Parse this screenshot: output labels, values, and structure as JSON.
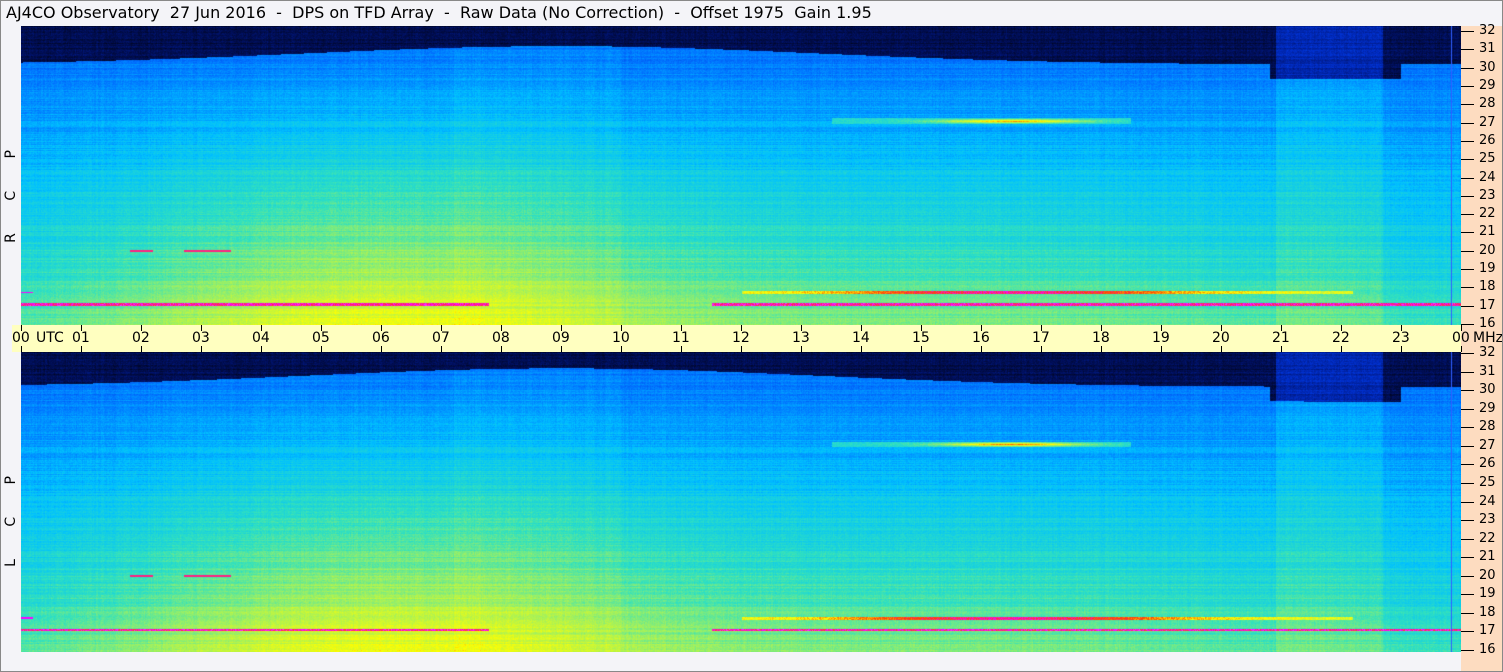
{
  "title": "AJ4CO Observatory  27 Jun 2016  -  DPS on TFD Array  -  Raw Data (No Correction)  -  Offset 1975  Gain 1.95",
  "chart_data": {
    "type": "heatmap",
    "title": "AJ4CO Observatory  27 Jun 2016  -  DPS on TFD Array  -  Raw Data (No Correction)  -  Offset 1975  Gain 1.95",
    "panels": [
      {
        "label": "R C P",
        "polarization": "RCP"
      },
      {
        "label": "L C P",
        "polarization": "LCP"
      }
    ],
    "x_axis": {
      "unit_label": "UTC",
      "range_hours": [
        0,
        24
      ],
      "tick_labels": [
        "00",
        "01",
        "02",
        "03",
        "04",
        "05",
        "06",
        "07",
        "08",
        "09",
        "10",
        "11",
        "12",
        "13",
        "14",
        "15",
        "16",
        "17",
        "18",
        "19",
        "20",
        "21",
        "22",
        "23",
        "00"
      ]
    },
    "y_axis": {
      "unit_label": "MHz",
      "range_mhz": [
        16,
        32
      ],
      "tick_labels": [
        "32",
        "31",
        "30",
        "29",
        "28",
        "27",
        "26",
        "25",
        "24",
        "23",
        "22",
        "21",
        "20",
        "19",
        "18",
        "17",
        "16"
      ]
    },
    "colormap": [
      "#000000",
      "#001060",
      "#0030d0",
      "#0070ff",
      "#00c0ff",
      "#30e0c0",
      "#a0f060",
      "#ffff00",
      "#ff4000",
      "#ff00ff",
      "#ffffff"
    ],
    "grid": false,
    "legend": "none"
  }
}
